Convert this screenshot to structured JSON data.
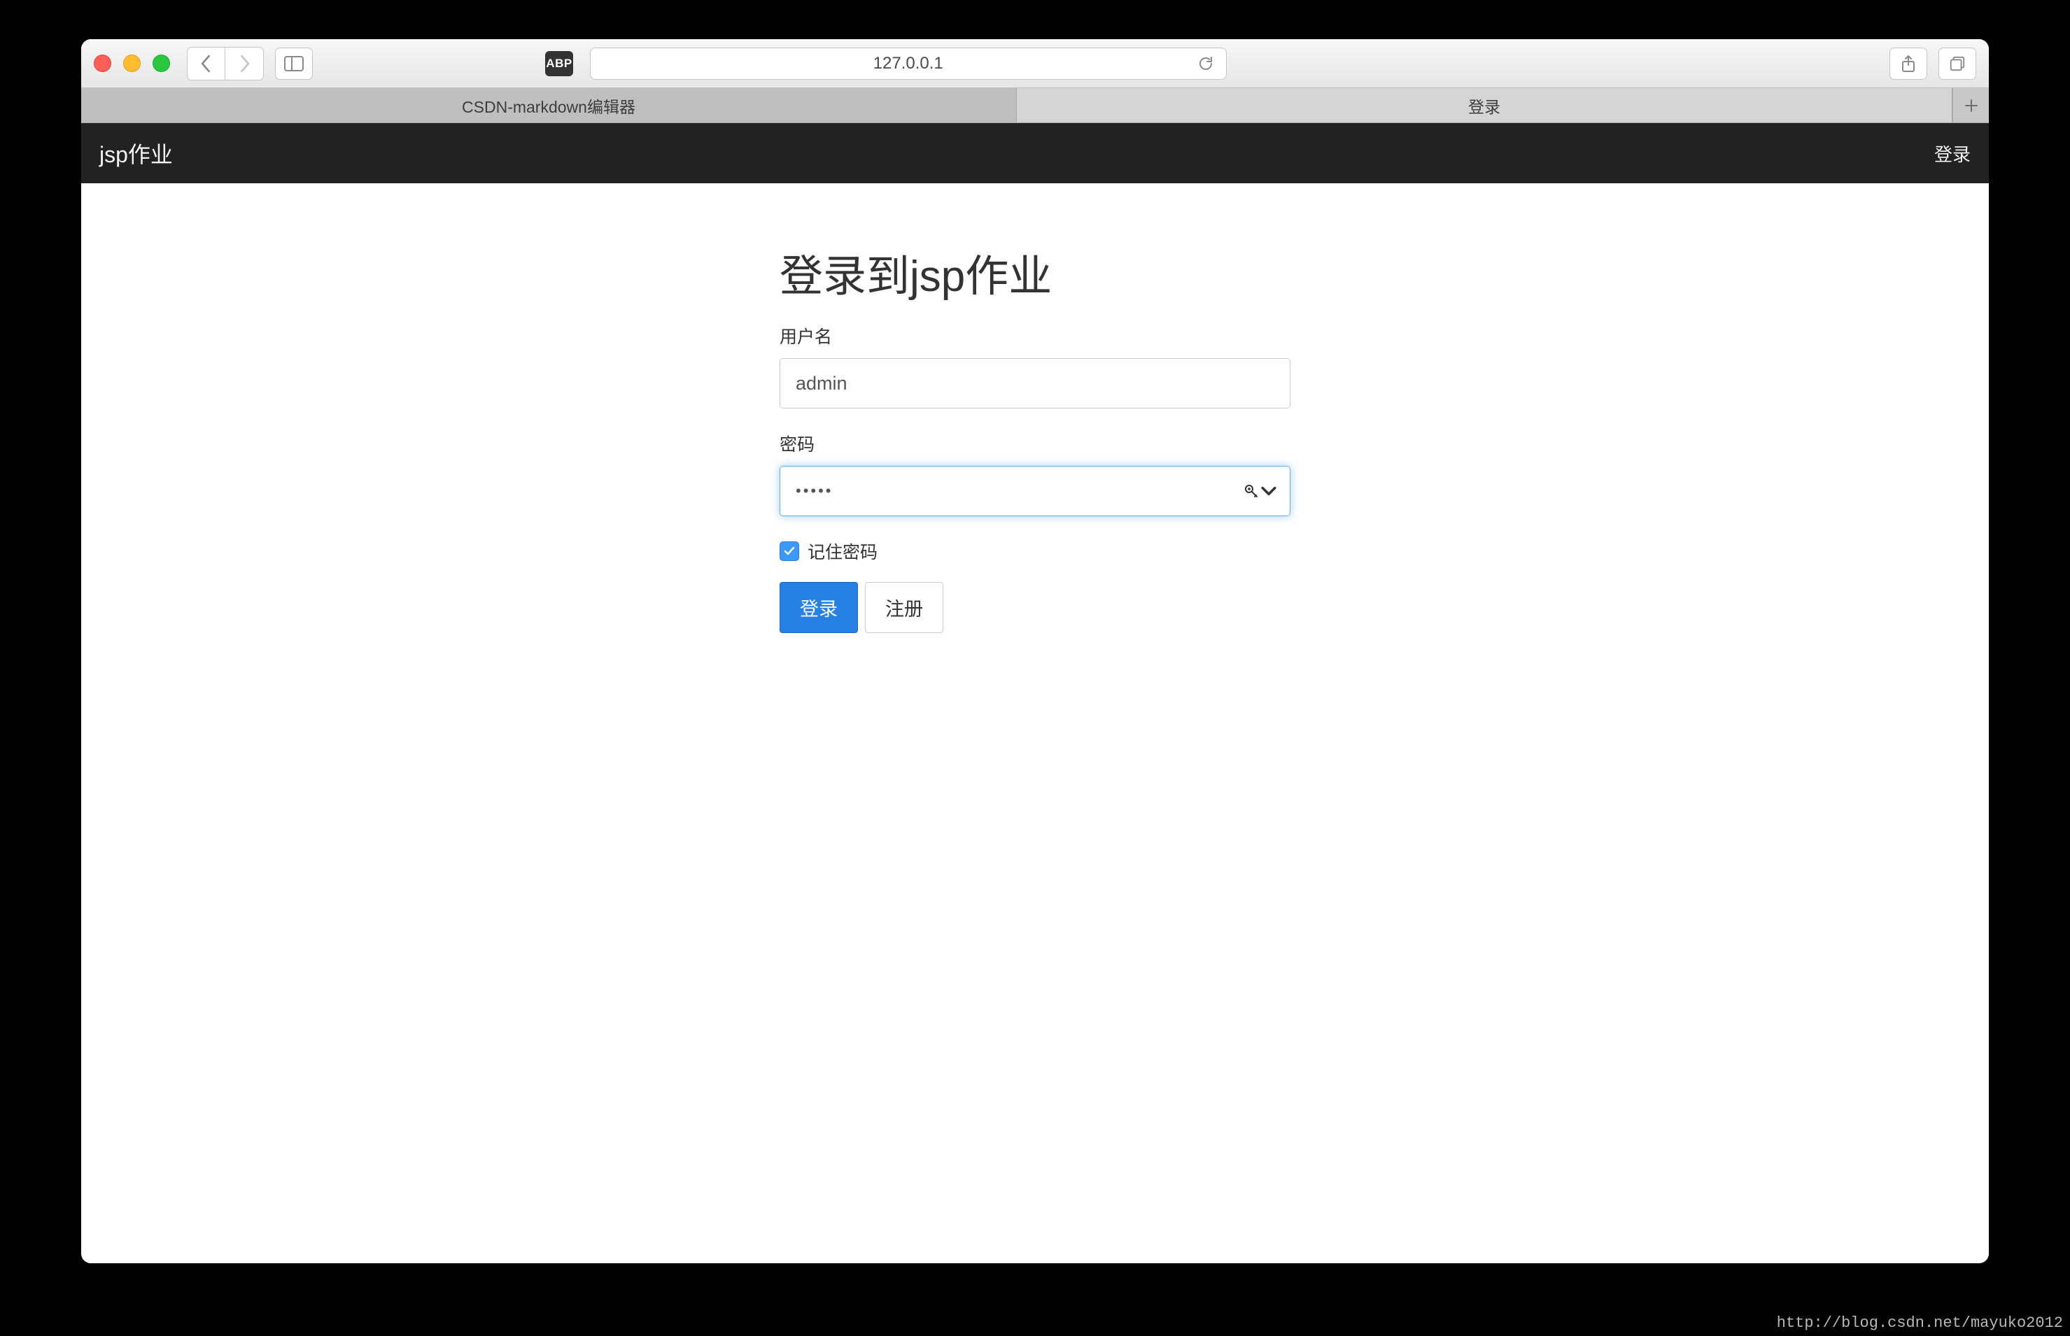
{
  "browser": {
    "address": "127.0.0.1",
    "abp_label": "ABP",
    "tabs": [
      {
        "label": "CSDN-markdown编辑器",
        "active": false
      },
      {
        "label": "登录",
        "active": true
      }
    ]
  },
  "navbar": {
    "brand": "jsp作业",
    "login_link": "登录"
  },
  "login": {
    "title": "登录到jsp作业",
    "username_label": "用户名",
    "username_value": "admin",
    "password_label": "密码",
    "password_value": "•••••",
    "remember_label": "记住密码",
    "remember_checked": true,
    "submit_label": "登录",
    "register_label": "注册"
  },
  "watermark": "http://blog.csdn.net/mayuko2012"
}
